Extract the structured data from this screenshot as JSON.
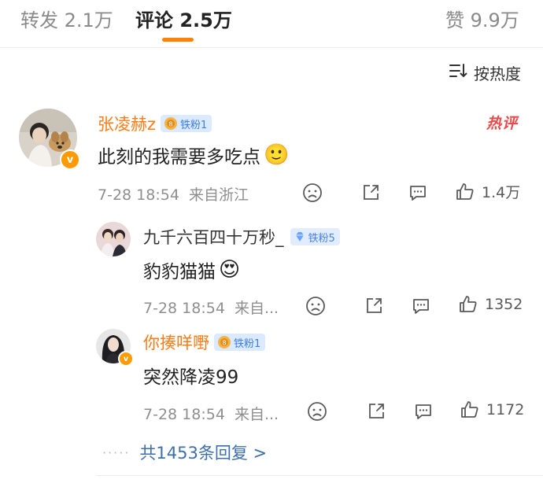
{
  "tabs": {
    "repost": {
      "label": "转发",
      "count": "2.1万"
    },
    "comment": {
      "label": "评论",
      "count": "2.5万"
    },
    "like": {
      "label": "赞",
      "count": "9.9万"
    }
  },
  "sort": {
    "label": "按热度"
  },
  "hot_label": "热评",
  "comment": {
    "username": "张凌赫z",
    "fan_badge": "铁粉1",
    "text": "此刻的我需要多吃点",
    "emoji": "🙂",
    "time": "7-28 18:54",
    "location": "来自浙江",
    "likes": "1.4万"
  },
  "replies": [
    {
      "username": "九千六百四十万秒_",
      "fan_badge": "铁粉5",
      "text": "豹豹猫猫",
      "emoji": "😍",
      "time": "7-28 18:54",
      "location": "来自...",
      "likes": "1352"
    },
    {
      "username": "你揍咩嘢",
      "fan_badge": "铁粉1",
      "text": "突然降凌99",
      "time": "7-28 18:54",
      "location": "来自...",
      "likes": "1172"
    }
  ],
  "more_replies": {
    "dots": "·····",
    "label": "共1453条回复 >"
  },
  "colors": {
    "accent": "#ff8200",
    "username": "#ff7b17",
    "link": "#3d6fb0",
    "hot": "#e94b4b"
  }
}
